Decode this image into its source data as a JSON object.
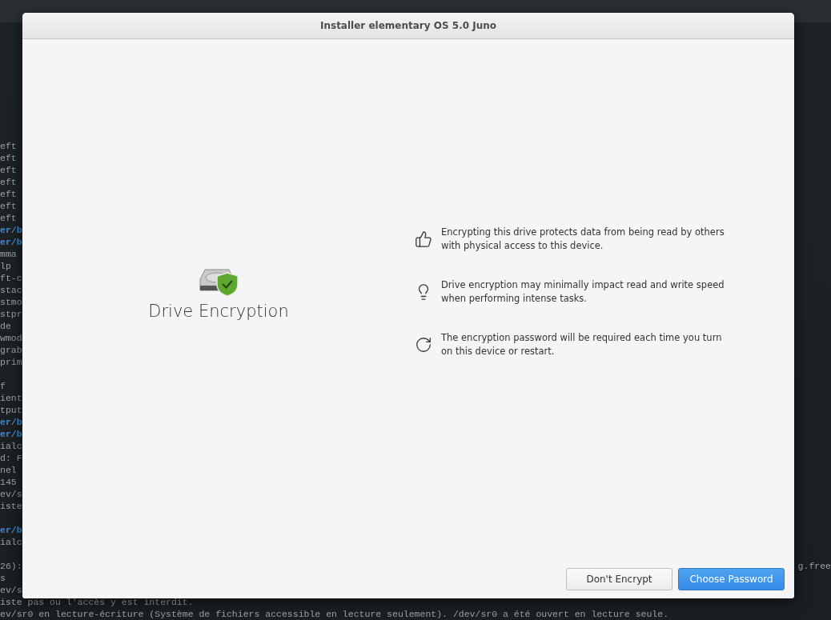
{
  "terminal": {
    "lines": [
      {
        "kind": "text",
        "text": "eft"
      },
      {
        "kind": "text",
        "text": "eft"
      },
      {
        "kind": "text",
        "text": "eft"
      },
      {
        "kind": "text",
        "text": "eft"
      },
      {
        "kind": "text",
        "text": "eft"
      },
      {
        "kind": "text",
        "text": "eft"
      },
      {
        "kind": "text",
        "text": "eft"
      },
      {
        "kind": "path",
        "text": "er/b"
      },
      {
        "kind": "path",
        "text": "er/b"
      },
      {
        "kind": "text",
        "text": "mma"
      },
      {
        "kind": "text",
        "text": "lp"
      },
      {
        "kind": "text",
        "text": "ft-c"
      },
      {
        "kind": "text",
        "text": "stac"
      },
      {
        "kind": "text",
        "text": "stmo"
      },
      {
        "kind": "text",
        "text": "stpr"
      },
      {
        "kind": "text",
        "text": "de"
      },
      {
        "kind": "text",
        "text": "wmod"
      },
      {
        "kind": "text",
        "text": "grab"
      },
      {
        "kind": "text",
        "text": "prim"
      },
      {
        "kind": "blank"
      },
      {
        "kind": "text",
        "text": "f"
      },
      {
        "kind": "text",
        "text": "ient"
      },
      {
        "kind": "text",
        "text": "tput"
      },
      {
        "kind": "path",
        "text": "er/b"
      },
      {
        "kind": "path",
        "text": "er/b"
      },
      {
        "kind": "text",
        "text": "ialc"
      },
      {
        "kind": "text",
        "text": "d: F"
      },
      {
        "kind": "text",
        "text": "nel"
      },
      {
        "kind": "text",
        "text": "145"
      },
      {
        "kind": "text",
        "text": "ev/s"
      },
      {
        "kind": "text",
        "text": "iste"
      },
      {
        "kind": "blank"
      },
      {
        "kind": "path",
        "text": "er/b"
      },
      {
        "kind": "text",
        "text": "ialc"
      },
      {
        "kind": "blank"
      },
      {
        "kind": "text",
        "text": "26):",
        "right_text": "g.free"
      },
      {
        "kind": "text",
        "text": "s"
      },
      {
        "kind": "text",
        "text": "ev/s"
      },
      {
        "kind": "text",
        "text": "iste pas ou l'accès y est interdit."
      },
      {
        "kind": "text",
        "text": "ev/sr0 en lecture-écriture (Système de fichiers accessible en lecture seulement). /dev/sr0 a été ouvert en lecture seule."
      }
    ]
  },
  "window": {
    "title": "Installer elementary OS 5.0 Juno"
  },
  "heading": "Drive Encryption",
  "points": [
    {
      "text": "Encrypting this drive protects data from being read by others with physical access to this device."
    },
    {
      "text": "Drive encryption may minimally impact read and write speed when performing intense tasks."
    },
    {
      "text": "The encryption password will be required each time you turn on this device or restart."
    }
  ],
  "buttons": [
    {
      "label": "Don't Encrypt",
      "kind": "default"
    },
    {
      "label": "Choose Password",
      "kind": "suggested"
    }
  ]
}
